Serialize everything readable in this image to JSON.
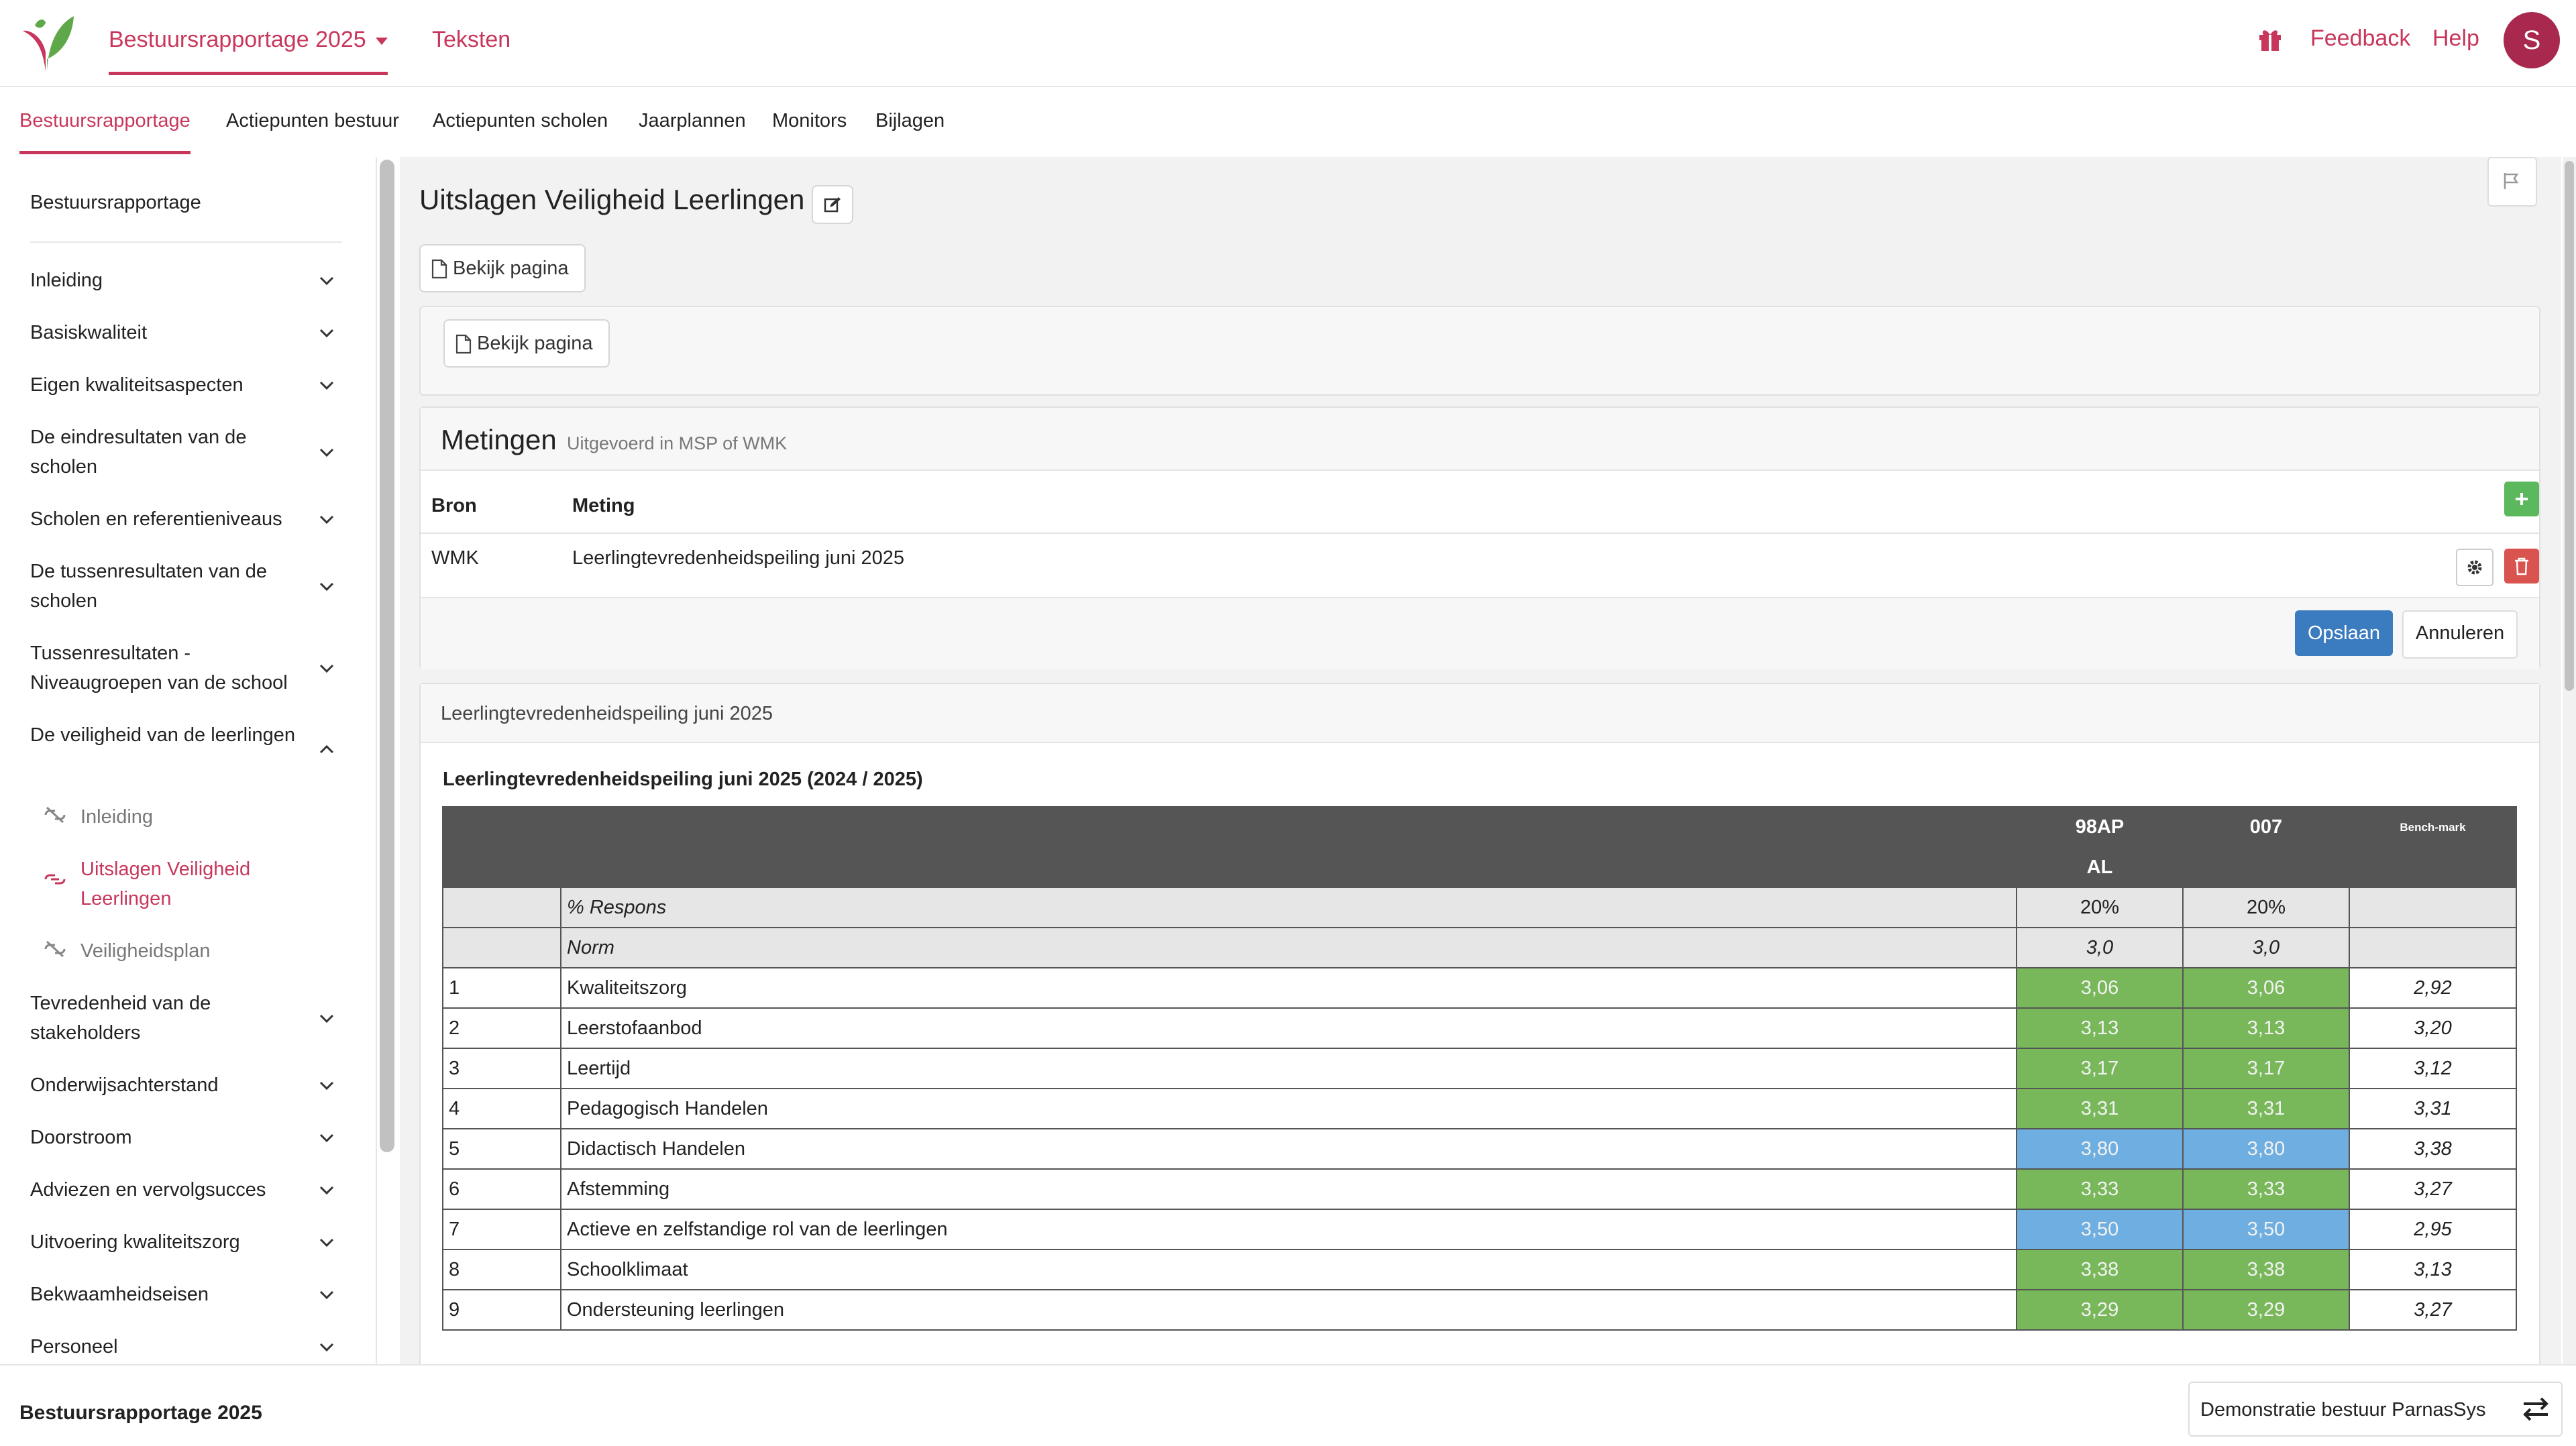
{
  "header": {
    "report_tab": "Bestuursrapportage 2025",
    "texts_tab": "Teksten",
    "feedback": "Feedback",
    "help": "Help",
    "avatar_initial": "S",
    "brand_color": "#c8375b"
  },
  "subnav": [
    "Bestuursrapportage",
    "Actiepunten bestuur",
    "Actiepunten scholen",
    "Jaarplannen",
    "Monitors",
    "Bijlagen"
  ],
  "sidebar": {
    "top": "Bestuursrapportage",
    "items": [
      "Inleiding",
      "Basiskwaliteit",
      "Eigen kwaliteitsaspecten",
      "De eindresultaten van de scholen",
      "Scholen en referentieniveaus",
      "De tussenresultaten van de scholen",
      "Tussenresultaten - Niveaugroepen van de school",
      "De veiligheid van de leerlingen",
      "Tevredenheid van de stakeholders",
      "Onderwijsachterstand",
      "Doorstroom",
      "Adviezen en vervolgsucces",
      "Uitvoering kwaliteitszorg",
      "Bekwaamheidseisen",
      "Personeel"
    ],
    "subitems": [
      "Inleiding",
      "Uitslagen Veiligheid Leerlingen",
      "Veiligheidsplan"
    ]
  },
  "main": {
    "title": "Uitslagen Veiligheid Leerlingen",
    "view_page": "Bekijk pagina",
    "metingen_title": "Metingen",
    "metingen_subtitle": "Uitgevoerd in MSP of WMK",
    "col_bron": "Bron",
    "col_meting": "Meting",
    "row_bron": "WMK",
    "row_meting": "Leerlingtevredenheidspeiling juni 2025",
    "save": "Opslaan",
    "cancel": "Annuleren",
    "section_title": "Leerlingtevredenheidspeiling juni 2025",
    "table_title": "Leerlingtevredenheidspeiling juni 2025 (2024 / 2025)"
  },
  "results": {
    "headers": [
      "98AP",
      "007",
      "Bench-mark"
    ],
    "subheader": "AL",
    "respons_label": "% Respons",
    "respons": [
      "20%",
      "20%"
    ],
    "norm_label": "Norm",
    "norm": [
      "3,0",
      "3,0"
    ],
    "rows": [
      {
        "nr": "1",
        "name": "Kwaliteitszorg",
        "a": "3,06",
        "b": "3,06",
        "bench": "2,92",
        "color": "green"
      },
      {
        "nr": "2",
        "name": "Leerstofaanbod",
        "a": "3,13",
        "b": "3,13",
        "bench": "3,20",
        "color": "green"
      },
      {
        "nr": "3",
        "name": "Leertijd",
        "a": "3,17",
        "b": "3,17",
        "bench": "3,12",
        "color": "green"
      },
      {
        "nr": "4",
        "name": "Pedagogisch Handelen",
        "a": "3,31",
        "b": "3,31",
        "bench": "3,31",
        "color": "green"
      },
      {
        "nr": "5",
        "name": "Didactisch Handelen",
        "a": "3,80",
        "b": "3,80",
        "bench": "3,38",
        "color": "blue"
      },
      {
        "nr": "6",
        "name": "Afstemming",
        "a": "3,33",
        "b": "3,33",
        "bench": "3,27",
        "color": "green"
      },
      {
        "nr": "7",
        "name": "Actieve en zelfstandige rol van de leerlingen",
        "a": "3,50",
        "b": "3,50",
        "bench": "2,95",
        "color": "blue"
      },
      {
        "nr": "8",
        "name": "Schoolklimaat",
        "a": "3,38",
        "b": "3,38",
        "bench": "3,13",
        "color": "green"
      },
      {
        "nr": "9",
        "name": "Ondersteuning leerlingen",
        "a": "3,29",
        "b": "3,29",
        "bench": "3,27",
        "color": "green"
      }
    ],
    "status_colors": {
      "green": "#79b85a",
      "blue": "#6eaee0"
    }
  },
  "footer": {
    "left": "Bestuursrapportage 2025",
    "right": "Demonstratie bestuur ParnasSys"
  }
}
